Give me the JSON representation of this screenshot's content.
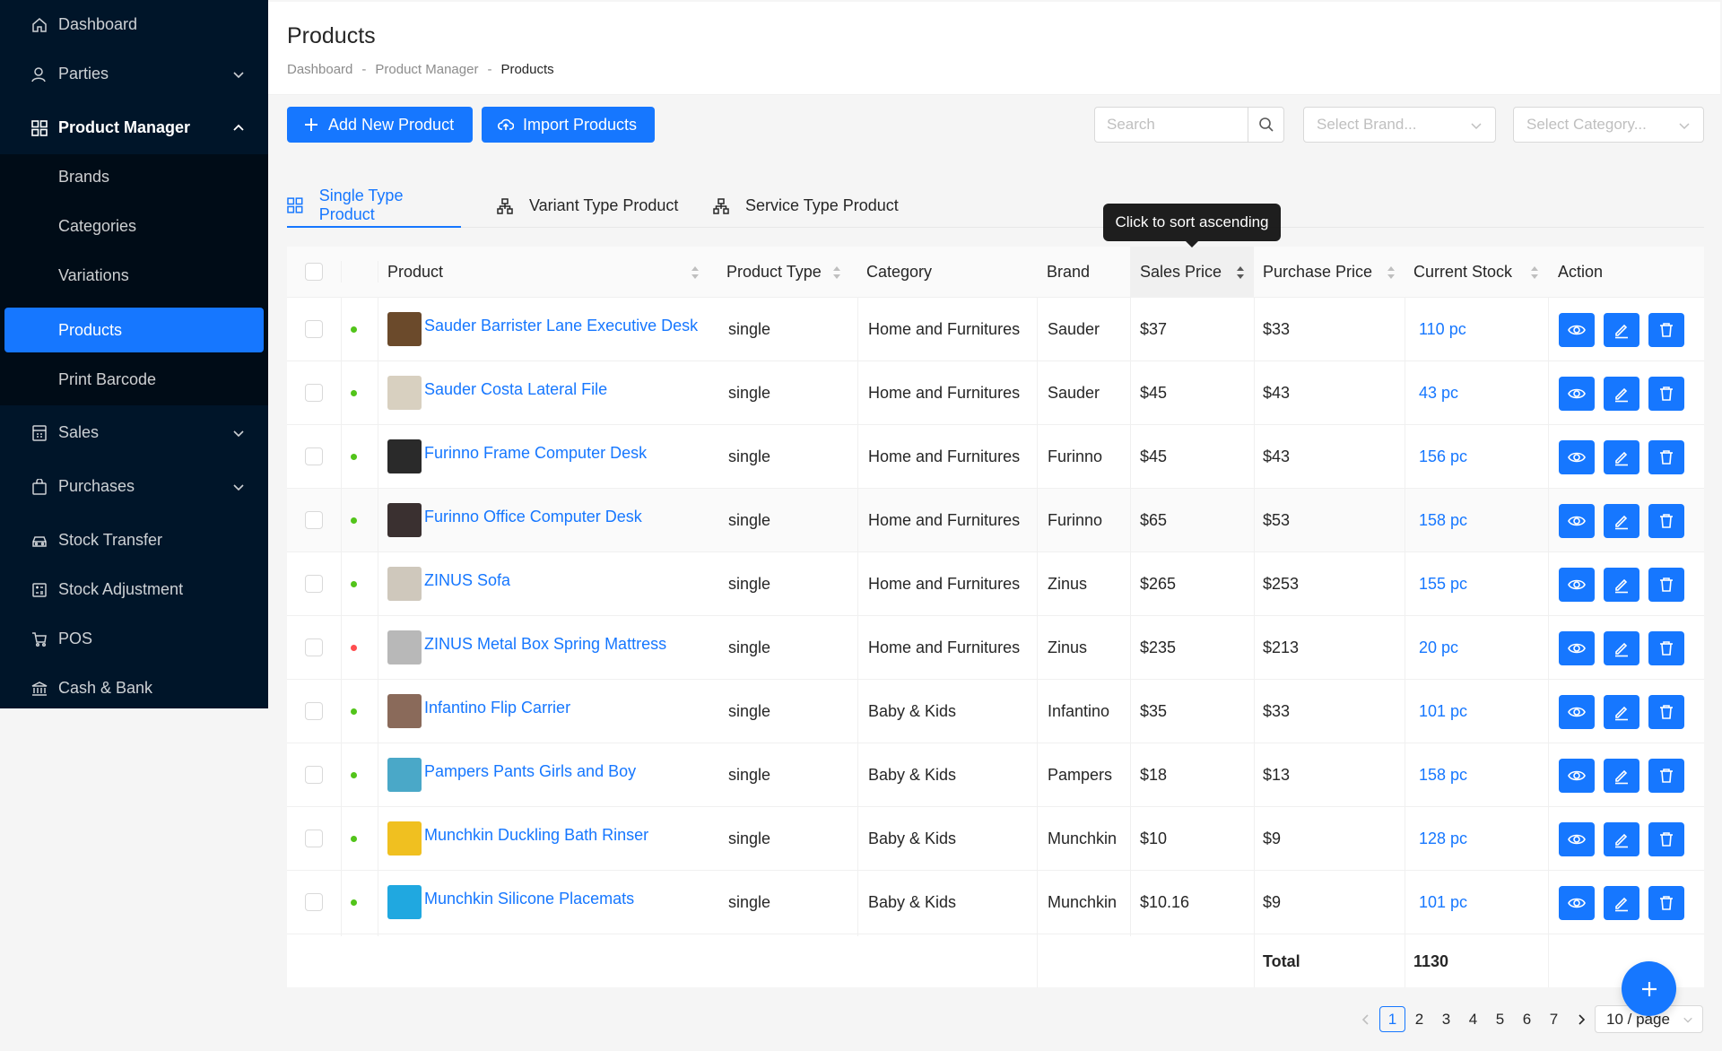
{
  "sidebar": {
    "items": [
      {
        "label": "Dashboard",
        "icon": "home-icon"
      },
      {
        "label": "Parties",
        "icon": "user-icon"
      },
      {
        "label": "Product Manager",
        "icon": "grid-icon"
      },
      {
        "label": "Sales",
        "icon": "calculator-icon"
      },
      {
        "label": "Purchases",
        "icon": "shopping-bag-icon"
      },
      {
        "label": "Stock Transfer",
        "icon": "car-icon"
      },
      {
        "label": "Stock Adjustment",
        "icon": "calculator-icon"
      },
      {
        "label": "POS",
        "icon": "cart-icon"
      },
      {
        "label": "Cash & Bank",
        "icon": "bank-icon"
      }
    ],
    "submenu": [
      "Brands",
      "Categories",
      "Variations",
      "Products",
      "Print Barcode"
    ],
    "selected": "Products"
  },
  "header": {
    "title": "Products",
    "breadcrumb": [
      "Dashboard",
      "-",
      "Product Manager",
      "-",
      "Products"
    ]
  },
  "toolbar": {
    "add_label": "Add New Product",
    "import_label": "Import Products",
    "search_placeholder": "Search",
    "brand_placeholder": "Select Brand...",
    "category_placeholder": "Select Category..."
  },
  "tabs": [
    "Single Type Product",
    "Variant Type Product",
    "Service Type Product"
  ],
  "tooltip": "Click to sort ascending",
  "table": {
    "columns": [
      "Product",
      "Product Type",
      "Category",
      "Brand",
      "Sales Price",
      "Purchase Price",
      "Current Stock",
      "Action"
    ],
    "rows": [
      {
        "name": "Sauder Barrister Lane Executive Desk",
        "type": "single",
        "category": "Home and Furnitures",
        "brand": "Sauder",
        "sales": "$37",
        "purchase": "$33",
        "stock": "110 pc",
        "status": "green",
        "thumb": "#6b4a2b"
      },
      {
        "name": "Sauder Costa Lateral File",
        "type": "single",
        "category": "Home and Furnitures",
        "brand": "Sauder",
        "sales": "$45",
        "purchase": "$43",
        "stock": "43 pc",
        "status": "green",
        "thumb": "#d8d0c0"
      },
      {
        "name": "Furinno Frame Computer Desk",
        "type": "single",
        "category": "Home and Furnitures",
        "brand": "Furinno",
        "sales": "$45",
        "purchase": "$43",
        "stock": "156 pc",
        "status": "green",
        "thumb": "#2a2a2a"
      },
      {
        "name": "Furinno Office Computer Desk",
        "type": "single",
        "category": "Home and Furnitures",
        "brand": "Furinno",
        "sales": "$65",
        "purchase": "$53",
        "stock": "158 pc",
        "status": "green",
        "thumb": "#3a3030"
      },
      {
        "name": "ZINUS Sofa",
        "type": "single",
        "category": "Home and Furnitures",
        "brand": "Zinus",
        "sales": "$265",
        "purchase": "$253",
        "stock": "155 pc",
        "status": "green",
        "thumb": "#cfc8bc"
      },
      {
        "name": "ZINUS Metal Box Spring Mattress",
        "type": "single",
        "category": "Home and Furnitures",
        "brand": "Zinus",
        "sales": "$235",
        "purchase": "$213",
        "stock": "20 pc",
        "status": "red",
        "thumb": "#b8b8b8"
      },
      {
        "name": "Infantino Flip Carrier",
        "type": "single",
        "category": "Baby & Kids",
        "brand": "Infantino",
        "sales": "$35",
        "purchase": "$33",
        "stock": "101 pc",
        "status": "green",
        "thumb": "#8a6a5a"
      },
      {
        "name": "Pampers Pants Girls and Boy",
        "type": "single",
        "category": "Baby & Kids",
        "brand": "Pampers",
        "sales": "$18",
        "purchase": "$13",
        "stock": "158 pc",
        "status": "green",
        "thumb": "#4aa8c8"
      },
      {
        "name": "Munchkin Duckling Bath Rinser",
        "type": "single",
        "category": "Baby & Kids",
        "brand": "Munchkin",
        "sales": "$10",
        "purchase": "$9",
        "stock": "128 pc",
        "status": "green",
        "thumb": "#f0c020"
      },
      {
        "name": "Munchkin Silicone Placemats",
        "type": "single",
        "category": "Baby & Kids",
        "brand": "Munchkin",
        "sales": "$10.16",
        "purchase": "$9",
        "stock": "101 pc",
        "status": "green",
        "thumb": "#20a8e0"
      }
    ],
    "total_label": "Total",
    "total_value": "1130"
  },
  "pagination": {
    "pages": [
      "1",
      "2",
      "3",
      "4",
      "5",
      "6",
      "7"
    ],
    "current": "1",
    "page_size": "10 / page"
  },
  "colors": {
    "primary": "#1677ff",
    "sidebar": "#001529",
    "status_green": "#52c41a",
    "status_red": "#ff4d4f"
  }
}
